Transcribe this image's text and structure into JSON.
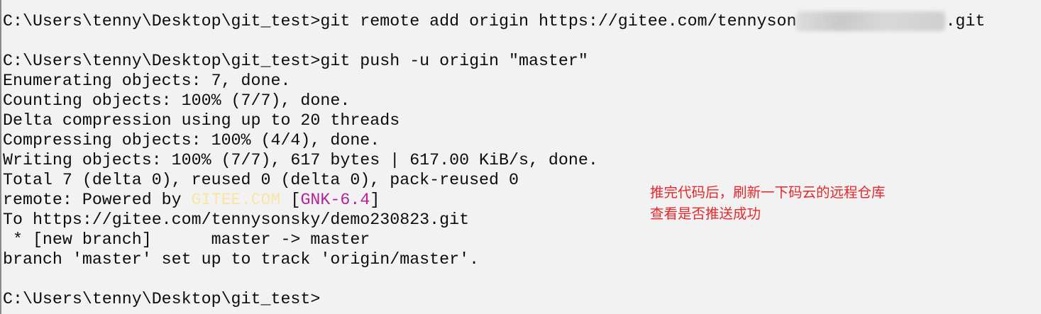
{
  "terminal": {
    "line1": {
      "prompt": "C:\\Users\\tenny\\Desktop\\git_test>",
      "cmd_before": "git remote add origin https://gitee.com/tennyson",
      "redacted": "sky/demo230823",
      "cmd_after": ".git"
    },
    "line2": "C:\\Users\\tenny\\Desktop\\git_test>git push -u origin \"master\"",
    "line3": "Enumerating objects: 7, done.",
    "line4": "Counting objects: 100% (7/7), done.",
    "line5": "Delta compression using up to 20 threads",
    "line6": "Compressing objects: 100% (4/4), done.",
    "line7": "Writing objects: 100% (7/7), 617 bytes | 617.00 KiB/s, done.",
    "line8": "Total 7 (delta 0), reused 0 (delta 0), pack-reused 0",
    "line9": {
      "prefix": "remote: Powered by ",
      "gitee": "GITEE.COM",
      "space": " ",
      "bracket_open": "[",
      "gnk": "GNK-6.4",
      "bracket_close": "]"
    },
    "line10": "To https://gitee.com/tennysonsky/demo230823.git",
    "line11": " * [new branch]      master -> master",
    "line12": "branch 'master' set up to track 'origin/master'.",
    "line13": "C:\\Users\\tenny\\Desktop\\git_test>"
  },
  "annotation": {
    "line1": "推完代码后，刷新一下码云的远程仓库",
    "line2": "查看是否推送成功",
    "color": "#e8262b"
  },
  "colors": {
    "background": "#f2f2f2",
    "text": "#0c0c0c",
    "gitee": "#f7e6a6",
    "gnk": "#b0259b"
  }
}
